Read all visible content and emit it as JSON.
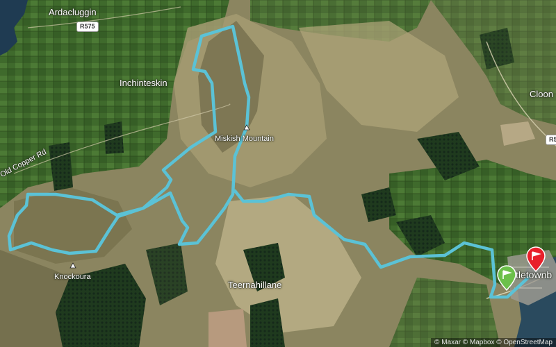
{
  "map": {
    "places": {
      "ardacluggin": "Ardacluggin",
      "inchinteskin": "Inchinteskin",
      "miskish": "Miskish Mountain",
      "knockoura": "Knockoura",
      "teernahillane": "Teernahillane",
      "old_copper_rd": "Old Copper Rd",
      "cloon": "Cloon",
      "town_partial": "tletownb"
    },
    "roads": {
      "r575": "R575",
      "r5_partial": "R5"
    },
    "markers": {
      "start": {
        "type": "start-pin",
        "color": "#6cc04a"
      },
      "finish": {
        "type": "finish-pin",
        "color": "#e8202a"
      }
    },
    "route": {
      "color": "#5bc2d6"
    },
    "attribution": "© Maxar © Mapbox © OpenStreetMap"
  }
}
